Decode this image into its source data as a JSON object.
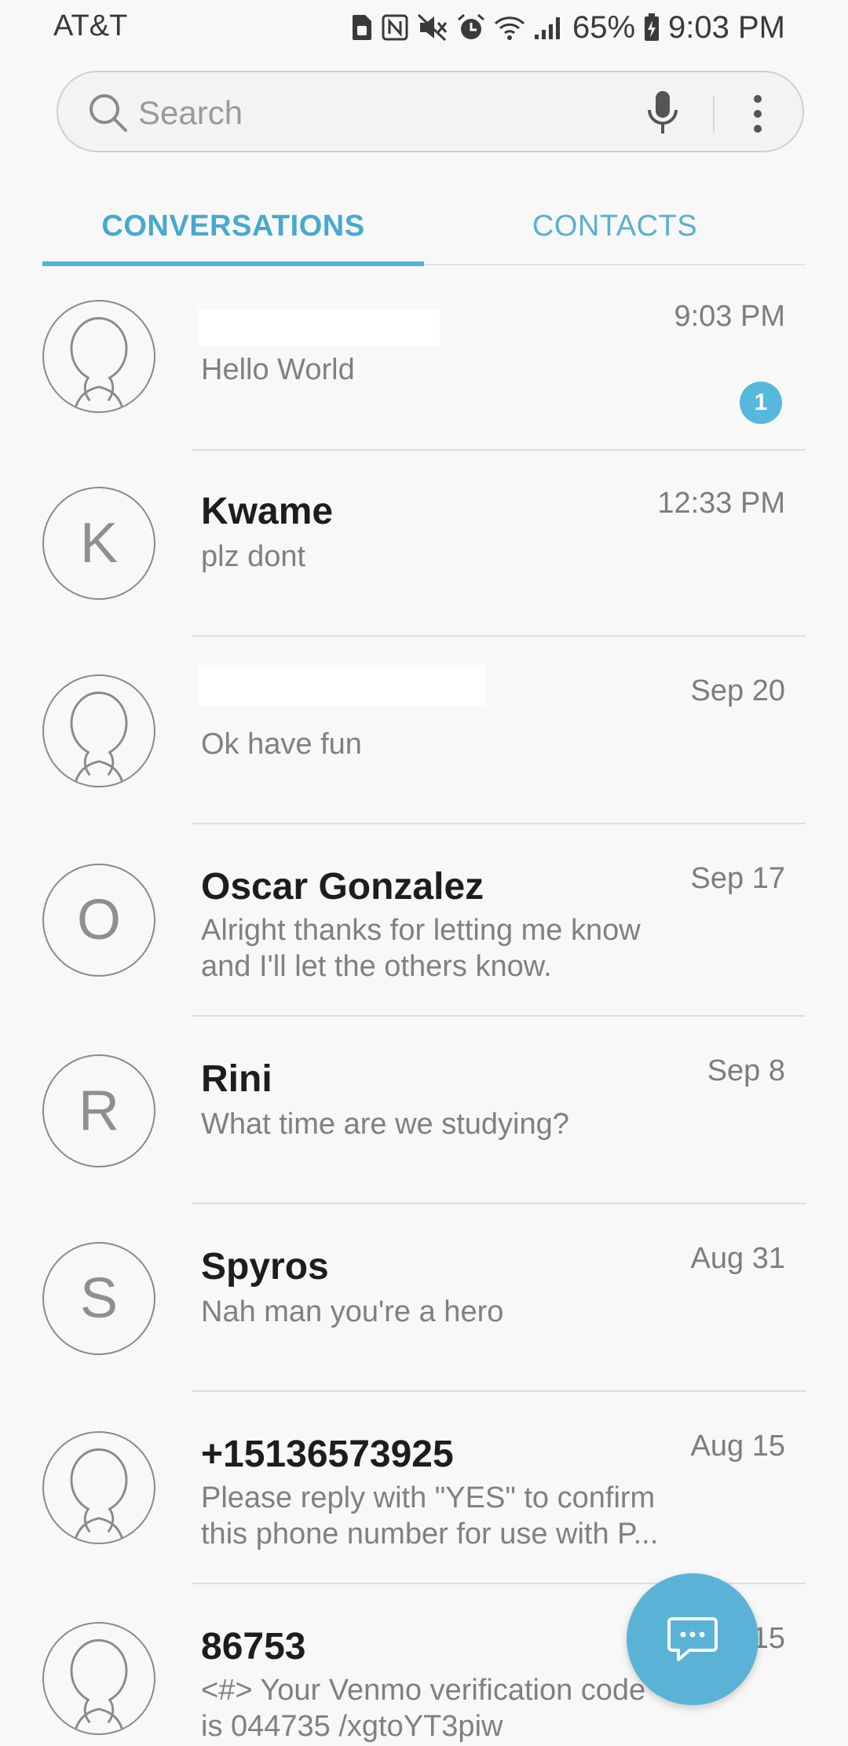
{
  "status_bar": {
    "carrier": "AT&T",
    "battery": "65%",
    "time": "9:03 PM",
    "icons": [
      "sim-card-icon",
      "nfc-icon",
      "mute-icon",
      "alarm-icon",
      "wifi-icon",
      "signal-icon",
      "battery-charging-icon"
    ]
  },
  "search": {
    "placeholder": "Search",
    "value": ""
  },
  "tabs": [
    {
      "label": "CONVERSATIONS",
      "selected": true
    },
    {
      "label": "CONTACTS",
      "selected": false
    }
  ],
  "conversations": [
    {
      "name": "",
      "snippet": "Hello World",
      "time": "9:03 PM",
      "unread": "1",
      "avatar": "person-icon"
    },
    {
      "name": "Kwame",
      "snippet": "plz dont",
      "time": "12:33 PM",
      "avatar_letter": "K"
    },
    {
      "name": "",
      "snippet": "Ok have fun",
      "time": "Sep 20",
      "avatar": "person-icon"
    },
    {
      "name": "Oscar Gonzalez",
      "snippet": "Alright thanks for letting me know and I'll let the others know.",
      "time": "Sep 17",
      "avatar_letter": "O"
    },
    {
      "name": "Rini",
      "snippet": "What time are we studying?",
      "time": "Sep 8",
      "avatar_letter": "R"
    },
    {
      "name": "Spyros",
      "snippet": "Nah man you're a hero",
      "time": "Aug 31",
      "avatar_letter": "S"
    },
    {
      "name": "+15136573925",
      "snippet": "Please reply with \"YES\" to confirm this phone number for use with P...",
      "time": "Aug 15",
      "avatar": "person-icon"
    },
    {
      "name": "86753",
      "snippet": "<#> Your Venmo verification code is 044735 /xgtoYT3piw",
      "time": "Aug 15",
      "avatar": "person-icon"
    }
  ],
  "colors": {
    "accent": "#4fb3d9",
    "fab": "#5ab3d6",
    "badge": "#56b8dc"
  }
}
